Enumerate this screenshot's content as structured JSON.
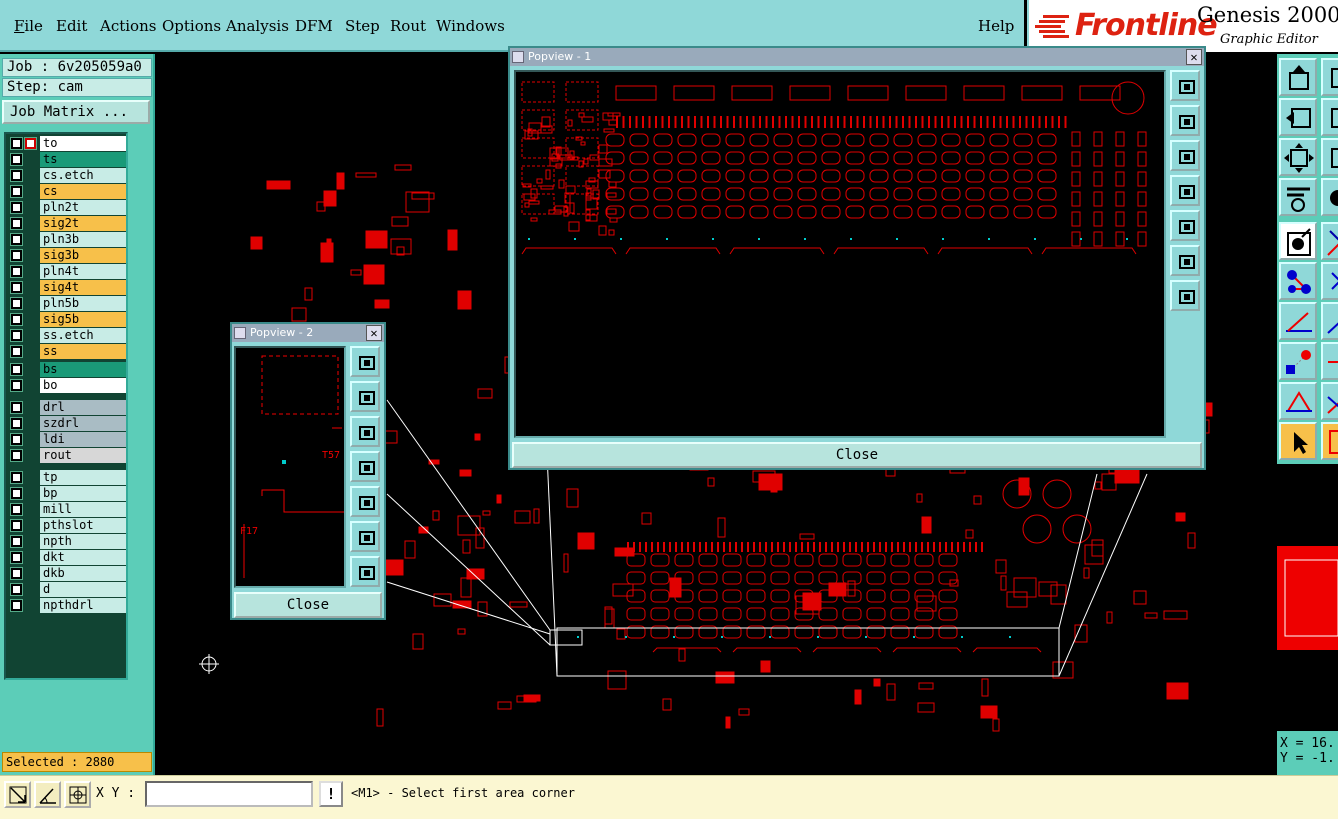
{
  "menubar": {
    "items": [
      "File",
      "Edit",
      "Actions",
      "Options",
      "Analysis",
      "DFM",
      "Step",
      "Rout",
      "Windows"
    ],
    "help": "Help"
  },
  "brand": {
    "logo": "Frontline",
    "title": "Genesis 2000",
    "subtitle": "Graphic Editor"
  },
  "left_panel": {
    "job": "Job : 6v205059a0",
    "step": "Step: cam",
    "job_matrix": "Job Matrix ...",
    "selected": "Selected : 2880"
  },
  "layers": [
    {
      "name": "to",
      "color": "#ffffff"
    },
    {
      "name": "ts",
      "color": "#1a9a78"
    },
    {
      "name": "cs.etch",
      "color": "#c8ece6"
    },
    {
      "name": "cs",
      "color": "#f7c04a"
    },
    {
      "name": "pln2t",
      "color": "#c8ece6"
    },
    {
      "name": "sig2t",
      "color": "#f7c04a"
    },
    {
      "name": "pln3b",
      "color": "#c8ece6"
    },
    {
      "name": "sig3b",
      "color": "#f7c04a"
    },
    {
      "name": "pln4t",
      "color": "#c8ece6"
    },
    {
      "name": "sig4t",
      "color": "#f7c04a"
    },
    {
      "name": "pln5b",
      "color": "#c8ece6"
    },
    {
      "name": "sig5b",
      "color": "#f7c04a"
    },
    {
      "name": "ss.etch",
      "color": "#c8ece6"
    },
    {
      "name": "ss",
      "color": "#f7c04a"
    },
    {
      "name": "bs",
      "color": "#1a9a78"
    },
    {
      "name": "bo",
      "color": "#ffffff"
    },
    {
      "name": "drl",
      "color": "#a9bcc4"
    },
    {
      "name": "szdrl",
      "color": "#a9bcc4"
    },
    {
      "name": "ldi",
      "color": "#a9bcc4"
    },
    {
      "name": "rout",
      "color": "#d7d7d7"
    },
    {
      "name": "tp",
      "color": "#c8ece6"
    },
    {
      "name": "bp",
      "color": "#c8ece6"
    },
    {
      "name": "mill",
      "color": "#c8ece6"
    },
    {
      "name": "pthslot",
      "color": "#c8ece6"
    },
    {
      "name": "npth",
      "color": "#c8ece6"
    },
    {
      "name": "dkt",
      "color": "#c8ece6"
    },
    {
      "name": "dkb",
      "color": "#c8ece6"
    },
    {
      "name": "d",
      "color": "#c8ece6"
    },
    {
      "name": "npthdrl",
      "color": "#c8ece6"
    }
  ],
  "popview1": {
    "title": "Popview - 1",
    "close_label": "Close"
  },
  "popview2": {
    "title": "Popview - 2",
    "close_label": "Close",
    "ref_labels": [
      "T57",
      "F17"
    ]
  },
  "coords": {
    "x": "X = 16.",
    "y": "Y = -1."
  },
  "status": {
    "xy_label": "X Y :",
    "xy_value": "",
    "warn": "!",
    "prompt": "<M1> - Select first area corner"
  },
  "colors": {
    "board": "#e00000",
    "panel": "#8fd8d8",
    "accent": "#5ccdb8",
    "highlight": "#f7c04a"
  }
}
